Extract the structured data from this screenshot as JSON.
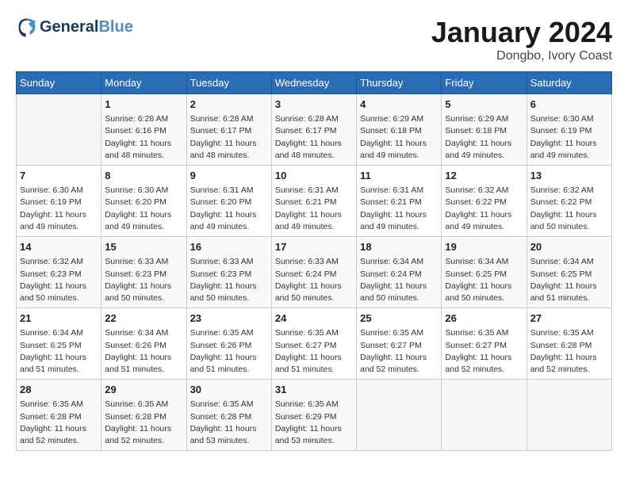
{
  "header": {
    "logo_line1": "General",
    "logo_line2": "Blue",
    "month": "January 2024",
    "location": "Dongbo, Ivory Coast"
  },
  "weekdays": [
    "Sunday",
    "Monday",
    "Tuesday",
    "Wednesday",
    "Thursday",
    "Friday",
    "Saturday"
  ],
  "weeks": [
    [
      {
        "day": "",
        "info": ""
      },
      {
        "day": "1",
        "info": "Sunrise: 6:28 AM\nSunset: 6:16 PM\nDaylight: 11 hours\nand 48 minutes."
      },
      {
        "day": "2",
        "info": "Sunrise: 6:28 AM\nSunset: 6:17 PM\nDaylight: 11 hours\nand 48 minutes."
      },
      {
        "day": "3",
        "info": "Sunrise: 6:28 AM\nSunset: 6:17 PM\nDaylight: 11 hours\nand 48 minutes."
      },
      {
        "day": "4",
        "info": "Sunrise: 6:29 AM\nSunset: 6:18 PM\nDaylight: 11 hours\nand 49 minutes."
      },
      {
        "day": "5",
        "info": "Sunrise: 6:29 AM\nSunset: 6:18 PM\nDaylight: 11 hours\nand 49 minutes."
      },
      {
        "day": "6",
        "info": "Sunrise: 6:30 AM\nSunset: 6:19 PM\nDaylight: 11 hours\nand 49 minutes."
      }
    ],
    [
      {
        "day": "7",
        "info": "Sunrise: 6:30 AM\nSunset: 6:19 PM\nDaylight: 11 hours\nand 49 minutes."
      },
      {
        "day": "8",
        "info": "Sunrise: 6:30 AM\nSunset: 6:20 PM\nDaylight: 11 hours\nand 49 minutes."
      },
      {
        "day": "9",
        "info": "Sunrise: 6:31 AM\nSunset: 6:20 PM\nDaylight: 11 hours\nand 49 minutes."
      },
      {
        "day": "10",
        "info": "Sunrise: 6:31 AM\nSunset: 6:21 PM\nDaylight: 11 hours\nand 49 minutes."
      },
      {
        "day": "11",
        "info": "Sunrise: 6:31 AM\nSunset: 6:21 PM\nDaylight: 11 hours\nand 49 minutes."
      },
      {
        "day": "12",
        "info": "Sunrise: 6:32 AM\nSunset: 6:22 PM\nDaylight: 11 hours\nand 49 minutes."
      },
      {
        "day": "13",
        "info": "Sunrise: 6:32 AM\nSunset: 6:22 PM\nDaylight: 11 hours\nand 50 minutes."
      }
    ],
    [
      {
        "day": "14",
        "info": "Sunrise: 6:32 AM\nSunset: 6:23 PM\nDaylight: 11 hours\nand 50 minutes."
      },
      {
        "day": "15",
        "info": "Sunrise: 6:33 AM\nSunset: 6:23 PM\nDaylight: 11 hours\nand 50 minutes."
      },
      {
        "day": "16",
        "info": "Sunrise: 6:33 AM\nSunset: 6:23 PM\nDaylight: 11 hours\nand 50 minutes."
      },
      {
        "day": "17",
        "info": "Sunrise: 6:33 AM\nSunset: 6:24 PM\nDaylight: 11 hours\nand 50 minutes."
      },
      {
        "day": "18",
        "info": "Sunrise: 6:34 AM\nSunset: 6:24 PM\nDaylight: 11 hours\nand 50 minutes."
      },
      {
        "day": "19",
        "info": "Sunrise: 6:34 AM\nSunset: 6:25 PM\nDaylight: 11 hours\nand 50 minutes."
      },
      {
        "day": "20",
        "info": "Sunrise: 6:34 AM\nSunset: 6:25 PM\nDaylight: 11 hours\nand 51 minutes."
      }
    ],
    [
      {
        "day": "21",
        "info": "Sunrise: 6:34 AM\nSunset: 6:25 PM\nDaylight: 11 hours\nand 51 minutes."
      },
      {
        "day": "22",
        "info": "Sunrise: 6:34 AM\nSunset: 6:26 PM\nDaylight: 11 hours\nand 51 minutes."
      },
      {
        "day": "23",
        "info": "Sunrise: 6:35 AM\nSunset: 6:26 PM\nDaylight: 11 hours\nand 51 minutes."
      },
      {
        "day": "24",
        "info": "Sunrise: 6:35 AM\nSunset: 6:27 PM\nDaylight: 11 hours\nand 51 minutes."
      },
      {
        "day": "25",
        "info": "Sunrise: 6:35 AM\nSunset: 6:27 PM\nDaylight: 11 hours\nand 52 minutes."
      },
      {
        "day": "26",
        "info": "Sunrise: 6:35 AM\nSunset: 6:27 PM\nDaylight: 11 hours\nand 52 minutes."
      },
      {
        "day": "27",
        "info": "Sunrise: 6:35 AM\nSunset: 6:28 PM\nDaylight: 11 hours\nand 52 minutes."
      }
    ],
    [
      {
        "day": "28",
        "info": "Sunrise: 6:35 AM\nSunset: 6:28 PM\nDaylight: 11 hours\nand 52 minutes."
      },
      {
        "day": "29",
        "info": "Sunrise: 6:35 AM\nSunset: 6:28 PM\nDaylight: 11 hours\nand 52 minutes."
      },
      {
        "day": "30",
        "info": "Sunrise: 6:35 AM\nSunset: 6:28 PM\nDaylight: 11 hours\nand 53 minutes."
      },
      {
        "day": "31",
        "info": "Sunrise: 6:35 AM\nSunset: 6:29 PM\nDaylight: 11 hours\nand 53 minutes."
      },
      {
        "day": "",
        "info": ""
      },
      {
        "day": "",
        "info": ""
      },
      {
        "day": "",
        "info": ""
      }
    ]
  ]
}
